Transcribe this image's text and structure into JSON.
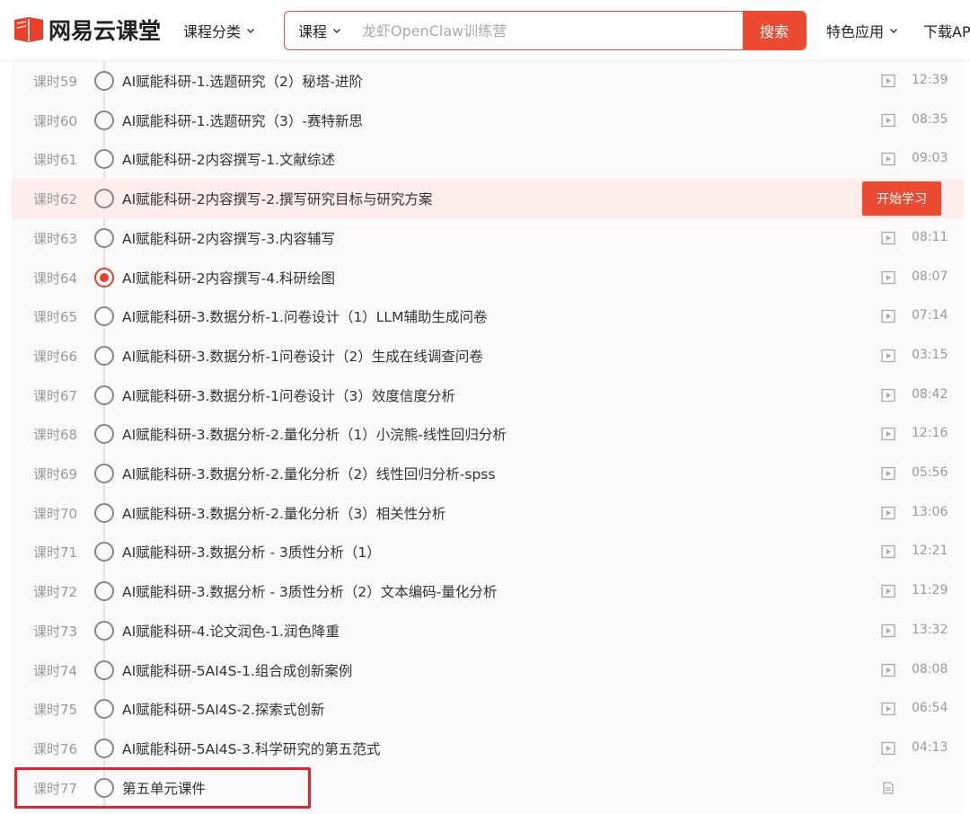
{
  "colors": {
    "accent": "#ec4b33",
    "highlight_bg": "#fdeeed",
    "annotation_box": "#e5232b"
  },
  "header": {
    "logo_text": "网易云课堂",
    "category_label": "课程分类",
    "search": {
      "type_label": "课程",
      "placeholder": "龙虾OpenClaw训练营",
      "button_label": "搜索"
    },
    "feature_label": "特色应用",
    "download_label": "下载AP"
  },
  "lessons": [
    {
      "index": "课时59",
      "title": "AI赋能科研-1.选题研究（2）秘塔-进阶",
      "duration": "12:39",
      "icon": "video-icon"
    },
    {
      "index": "课时60",
      "title": "AI赋能科研-1.选题研究（3）-赛特新思",
      "duration": "08:35",
      "icon": "video-icon"
    },
    {
      "index": "课时61",
      "title": "AI赋能科研-2内容撰写-1.文献综述",
      "duration": "09:03",
      "icon": "video-icon"
    },
    {
      "index": "课时62",
      "title": "AI赋能科研-2内容撰写-2.撰写研究目标与研究方案",
      "duration": "",
      "icon": "",
      "highlight": true,
      "action_label": "开始学习"
    },
    {
      "index": "课时63",
      "title": "AI赋能科研-2内容撰写-3.内容辅写",
      "duration": "08:11",
      "icon": "video-icon"
    },
    {
      "index": "课时64",
      "title": "AI赋能科研-2内容撰写-4.科研绘图",
      "duration": "08:07",
      "icon": "video-icon",
      "current": true
    },
    {
      "index": "课时65",
      "title": "AI赋能科研-3.数据分析-1.问卷设计（1）LLM辅助生成问卷",
      "duration": "07:14",
      "icon": "video-icon"
    },
    {
      "index": "课时66",
      "title": "AI赋能科研-3.数据分析-1问卷设计（2）生成在线调查问卷",
      "duration": "03:15",
      "icon": "video-icon"
    },
    {
      "index": "课时67",
      "title": "AI赋能科研-3.数据分析-1问卷设计（3）效度信度分析",
      "duration": "08:42",
      "icon": "video-icon"
    },
    {
      "index": "课时68",
      "title": "AI赋能科研-3.数据分析-2.量化分析（1）小浣熊-线性回归分析",
      "duration": "12:16",
      "icon": "video-icon"
    },
    {
      "index": "课时69",
      "title": "AI赋能科研-3.数据分析-2.量化分析（2）线性回归分析-spss",
      "duration": "05:56",
      "icon": "video-icon"
    },
    {
      "index": "课时70",
      "title": "AI赋能科研-3.数据分析-2.量化分析（3）相关性分析",
      "duration": "13:06",
      "icon": "video-icon"
    },
    {
      "index": "课时71",
      "title": "AI赋能科研-3.数据分析 - 3质性分析（1）",
      "duration": "12:21",
      "icon": "video-icon"
    },
    {
      "index": "课时72",
      "title": "AI赋能科研-3.数据分析 - 3质性分析（2）文本编码-量化分析",
      "duration": "11:29",
      "icon": "video-icon"
    },
    {
      "index": "课时73",
      "title": "AI赋能科研-4.论文润色-1.润色降重",
      "duration": "13:32",
      "icon": "video-icon"
    },
    {
      "index": "课时74",
      "title": "AI赋能科研-5AI4S-1.组合成创新案例",
      "duration": "08:08",
      "icon": "video-icon"
    },
    {
      "index": "课时75",
      "title": "AI赋能科研-5AI4S-2.探索式创新",
      "duration": "06:54",
      "icon": "video-icon"
    },
    {
      "index": "课时76",
      "title": "AI赋能科研-5AI4S-3.科学研究的第五范式",
      "duration": "04:13",
      "icon": "video-icon"
    },
    {
      "index": "课时77",
      "title": "第五单元课件",
      "duration": "",
      "icon": "document-icon"
    }
  ]
}
